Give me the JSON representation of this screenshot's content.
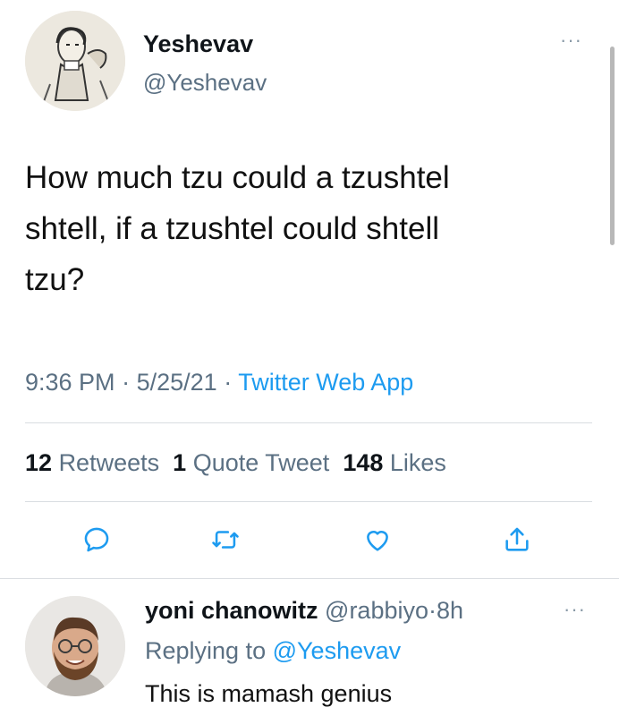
{
  "tweet": {
    "display_name": "Yeshevav",
    "handle": "@Yeshevav",
    "text_lines": [
      "How much tzu could a tzushtel",
      "shtell, if a tzushtel could shtell",
      "tzu?"
    ],
    "time": "9:36 PM",
    "date": "5/25/21",
    "separator": "·",
    "source": "Twitter Web App",
    "more_icon": "more-icon"
  },
  "stats": {
    "retweets_count": "12",
    "retweets_label": "Retweets",
    "quotes_count": "1",
    "quotes_label": "Quote Tweet",
    "likes_count": "148",
    "likes_label": "Likes"
  },
  "actions": {
    "reply_icon": "reply-icon",
    "retweet_icon": "retweet-icon",
    "like_icon": "heart-icon",
    "share_icon": "share-icon",
    "icon_color": "#1d9bf0"
  },
  "reply": {
    "display_name": "yoni chanowitz",
    "handle": "@rabbiyo",
    "separator": "·",
    "time": "8h",
    "replying_prefix": "Replying to",
    "replying_to": "@Yeshevav",
    "text": "This is mamash genius"
  },
  "colors": {
    "accent": "#1d9bf0",
    "muted": "#5b7083",
    "divider": "#d9dde1"
  }
}
